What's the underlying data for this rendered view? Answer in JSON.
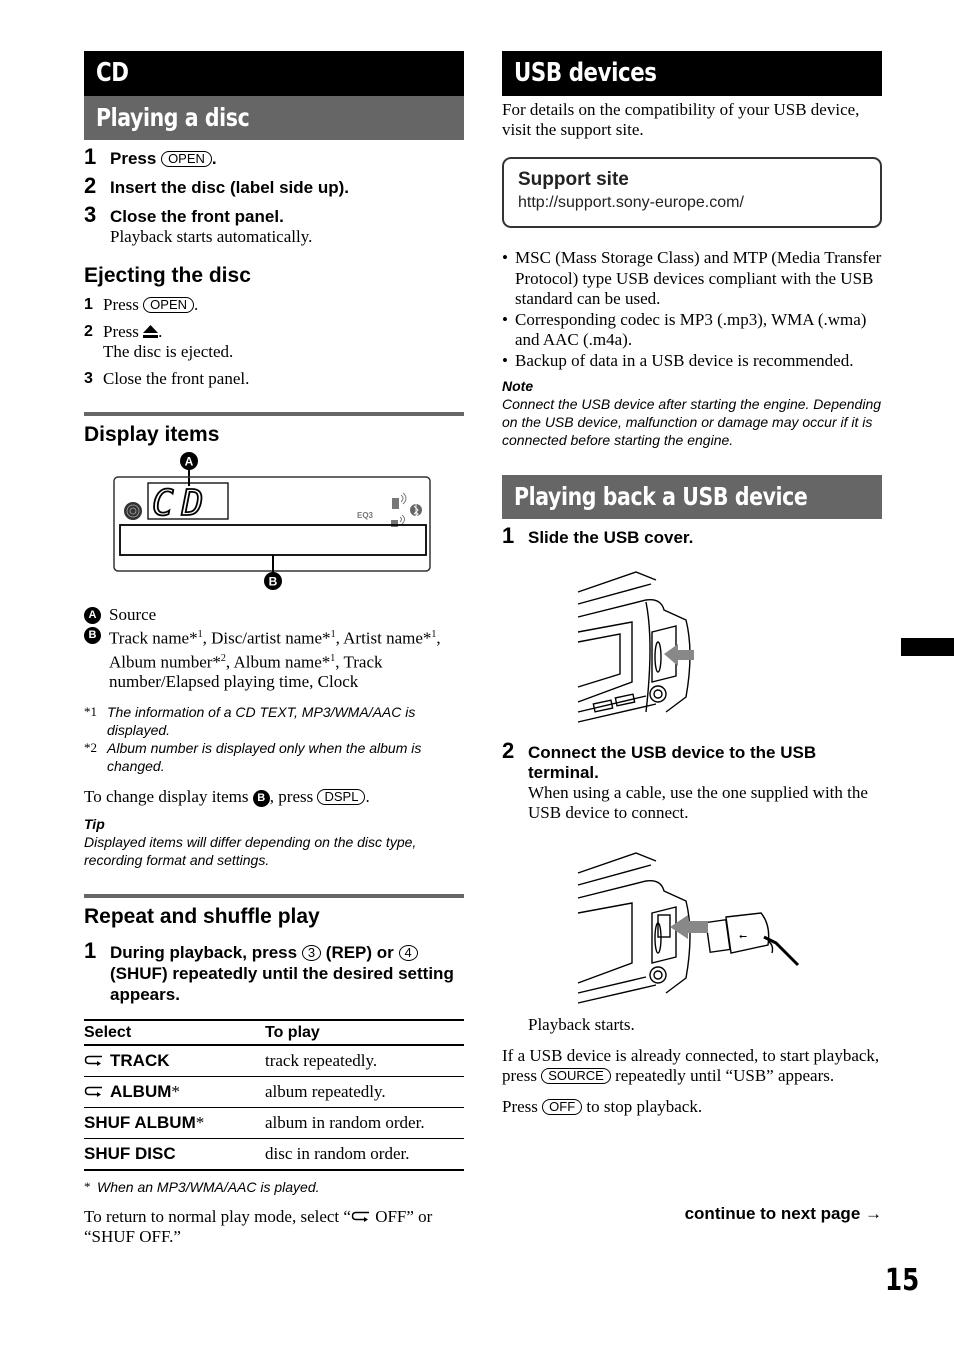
{
  "left": {
    "section_title": "CD",
    "playing_disc": {
      "title": "Playing a disc",
      "steps": [
        {
          "num": "1",
          "pre": "Press",
          "button": "OPEN",
          "post": "."
        },
        {
          "num": "2",
          "text": "Insert the disc (label side up)."
        },
        {
          "num": "3",
          "text": "Close the front panel.",
          "sub": "Playback starts automatically."
        }
      ]
    },
    "ejecting": {
      "title": "Ejecting the disc",
      "steps": [
        {
          "num": "1",
          "pre": "Press",
          "button": "OPEN",
          "post": "."
        },
        {
          "num": "2",
          "pre": "Press",
          "icon": "eject-icon",
          "post": ".",
          "sub": "The disc is ejected."
        },
        {
          "num": "3",
          "text": "Close the front panel."
        }
      ]
    },
    "display_items": {
      "title": "Display items",
      "display_text": "CD",
      "eq_label": "EQ3",
      "callouts": [
        "A",
        "B"
      ],
      "legend": [
        {
          "marker": "A",
          "text": "Source"
        },
        {
          "marker": "B",
          "parts": [
            "Track name*",
            "1",
            ", Disc/artist name*",
            "1",
            ", Artist name*",
            "1",
            ", Album number*",
            "2",
            ", Album name*",
            "1",
            ", Track number/Elapsed playing time, Clock"
          ]
        }
      ],
      "footnotes": [
        {
          "mark": "*1",
          "text": "The information of a CD TEXT, MP3/WMA/AAC is displayed."
        },
        {
          "mark": "*2",
          "text": "Album number is displayed only when the album is changed."
        }
      ],
      "change_text_pre": "To change display items",
      "change_marker": "B",
      "change_text_mid": ", press",
      "change_button": "DSPL",
      "change_text_post": ".",
      "tip_label": "Tip",
      "tip_text": "Displayed items will differ depending on the disc type, recording format and settings."
    },
    "repeat_shuffle": {
      "title": "Repeat and shuffle play",
      "step": {
        "num": "1",
        "t1": "During playback, press",
        "b1": "3",
        "t2": "(REP) or",
        "b2": "4",
        "t3": "(SHUF) repeatedly until the desired setting appears."
      },
      "table": {
        "headers": [
          "Select",
          "To play"
        ],
        "rows": [
          {
            "icon": "repeat-icon",
            "select": "TRACK",
            "asterisk": "",
            "play": "track repeatedly."
          },
          {
            "icon": "repeat-icon",
            "select": "ALBUM",
            "asterisk": "*",
            "play": "album repeatedly."
          },
          {
            "icon": "",
            "select": "SHUF ALBUM",
            "asterisk": "*",
            "play": "album in random order."
          },
          {
            "icon": "",
            "select": "SHUF DISC",
            "asterisk": "",
            "play": "disc in random order."
          }
        ]
      },
      "footnote_mark": "*",
      "footnote": "When an MP3/WMA/AAC is played.",
      "return_pre": "To return to normal play mode, select “",
      "return_mid": " OFF” or “SHUF OFF.”"
    }
  },
  "right": {
    "usb_devices": {
      "title": "USB devices",
      "intro": "For details on the compatibility of your USB device, visit the support site.",
      "support_title": "Support site",
      "support_url": "http://support.sony-europe.com/",
      "bullets": [
        "MSC (Mass Storage Class) and MTP (Media Transfer Protocol) type USB devices compliant with the USB standard can be used.",
        "Corresponding codec is MP3 (.mp3), WMA (.wma) and AAC (.m4a).",
        "Backup of data in a USB device is recommended."
      ],
      "note_label": "Note",
      "note_text": "Connect the USB device after starting the engine. Depending on the USB device, malfunction or damage may occur if it is connected before starting the engine."
    },
    "playing_usb": {
      "title": "Playing back a USB device",
      "step1": {
        "num": "1",
        "text": "Slide the USB cover."
      },
      "step2": {
        "num": "2",
        "text": "Connect the USB device to the USB terminal.",
        "sub": "When using a cable, use the one supplied with the USB device to connect."
      },
      "after": "Playback starts.",
      "already_pre": "If a USB device is already connected, to start playback, press",
      "already_button": "SOURCE",
      "already_post": "repeatedly until “USB” appears.",
      "stop_pre": "Press",
      "stop_button": "OFF",
      "stop_post": "to stop playback."
    },
    "continue": "continue to next page →"
  },
  "page_number": "15"
}
